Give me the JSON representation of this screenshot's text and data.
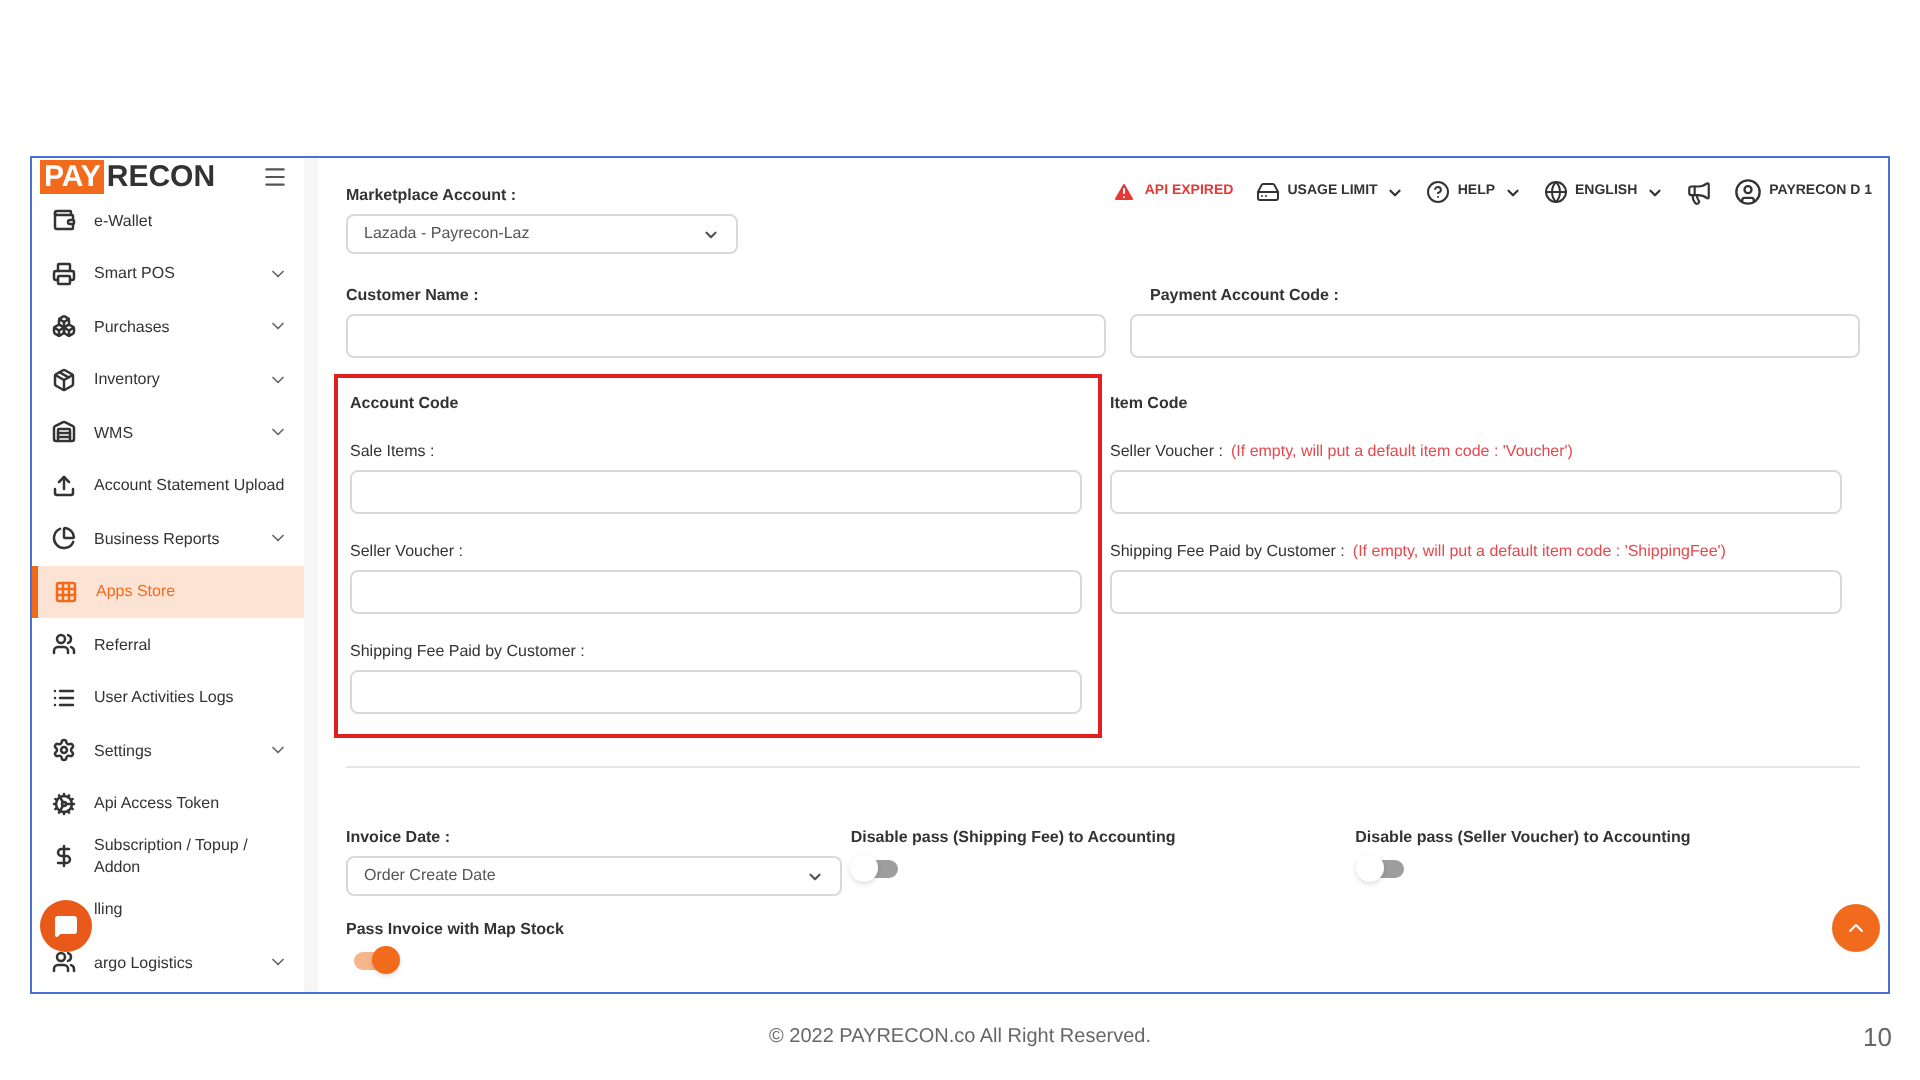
{
  "logo": {
    "part_1": "PAY",
    "part_2": "RECON"
  },
  "header": {
    "alert": "API EXPIRED",
    "usage": "USAGE LIMIT",
    "help": "HELP",
    "language": "ENGLISH",
    "user": "PAYRECON D 1"
  },
  "sidebar": {
    "items": [
      {
        "label": "e-Wallet",
        "expandable": false,
        "selected": false
      },
      {
        "label": "Smart POS",
        "expandable": true,
        "selected": false
      },
      {
        "label": "Purchases",
        "expandable": true,
        "selected": false
      },
      {
        "label": "Inventory",
        "expandable": true,
        "selected": false
      },
      {
        "label": "WMS",
        "expandable": true,
        "selected": false
      },
      {
        "label": "Account Statement Upload",
        "expandable": false,
        "selected": false
      },
      {
        "label": "Business Reports",
        "expandable": true,
        "selected": false
      },
      {
        "label": "Apps Store",
        "expandable": false,
        "selected": true
      },
      {
        "label": "Referral",
        "expandable": false,
        "selected": false
      },
      {
        "label": "User Activities Logs",
        "expandable": false,
        "selected": false
      },
      {
        "label": "Settings",
        "expandable": true,
        "selected": false
      },
      {
        "label": "Api Access Token",
        "expandable": false,
        "selected": false
      },
      {
        "label": "Subscription / Topup / Addon",
        "expandable": false,
        "selected": false
      },
      {
        "label": "lling",
        "expandable": false,
        "selected": false
      },
      {
        "label": "argo Logistics",
        "expandable": true,
        "selected": false
      }
    ]
  },
  "form": {
    "marketplace": {
      "label": "Marketplace Account :",
      "value": "Lazada - Payrecon-Laz"
    },
    "customer_name": {
      "label": "Customer Name :"
    },
    "payment_account_code": {
      "label": "Payment Account Code :"
    },
    "account_code": {
      "title": "Account Code",
      "fields": [
        {
          "label": "Sale Items :"
        },
        {
          "label": "Seller Voucher :"
        },
        {
          "label": "Shipping Fee Paid by Customer :"
        }
      ]
    },
    "item_code": {
      "title": "Item Code",
      "fields": [
        {
          "label": "Seller Voucher :",
          "hint": "(If empty, will put a default item code : 'Voucher')"
        },
        {
          "label": "Shipping Fee Paid by Customer :",
          "hint": "(If empty, will put a default item code : 'ShippingFee')"
        }
      ]
    },
    "invoice_date": {
      "label": "Invoice Date :",
      "value": "Order Create Date"
    },
    "toggles": [
      {
        "label": "Disable pass (Shipping Fee) to Accounting",
        "on": false
      },
      {
        "label": "Disable pass (Seller Voucher) to Accounting",
        "on": false
      },
      {
        "label": "Pass Invoice with Map Stock",
        "on": true
      }
    ]
  },
  "footer": {
    "copyright": "© 2022 PAYRECON.co All Right Reserved.",
    "page_number": "10"
  }
}
